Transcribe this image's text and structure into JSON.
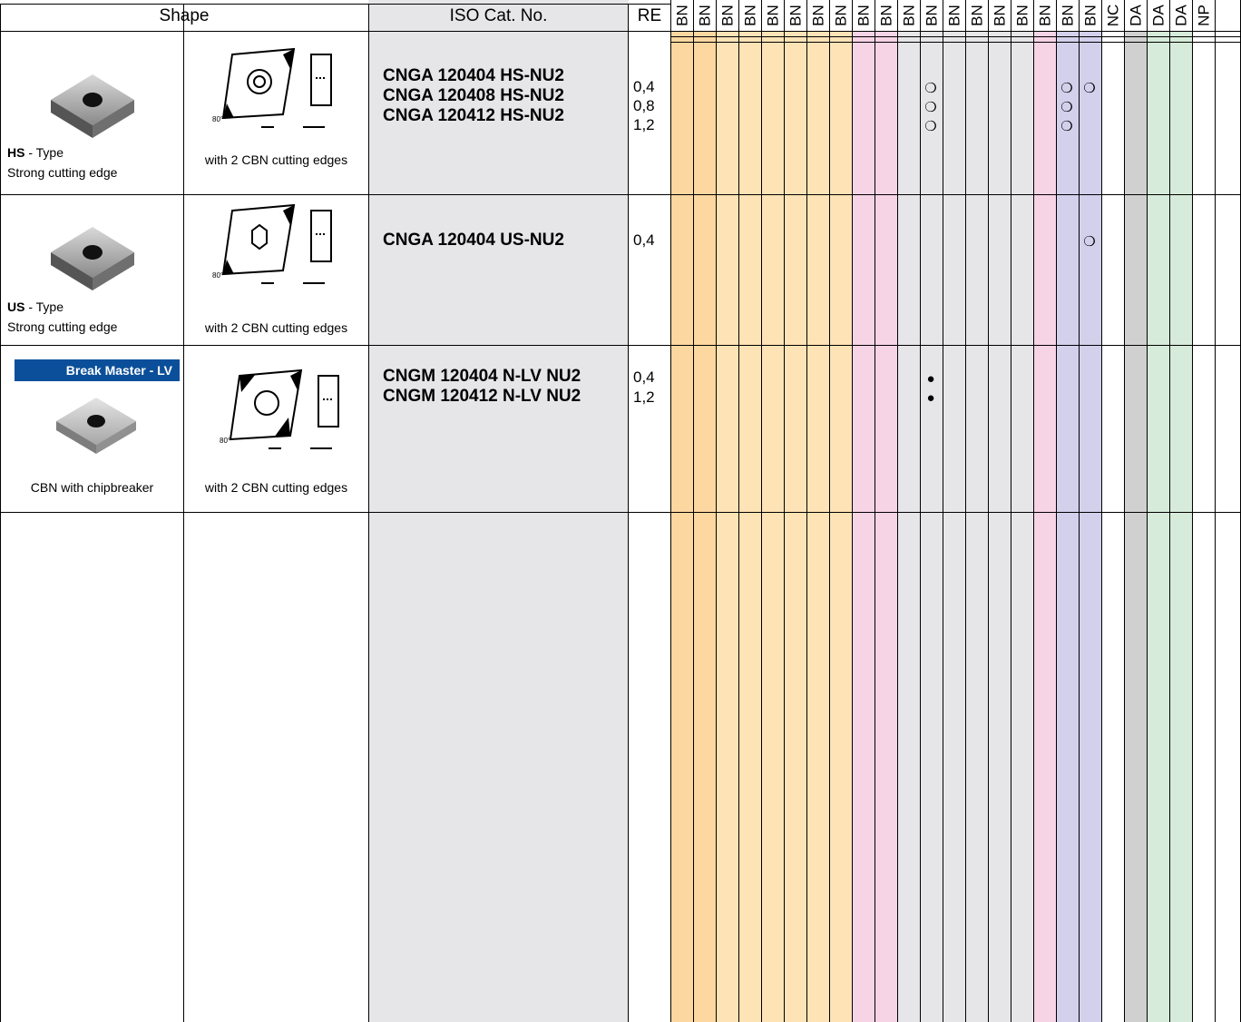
{
  "header": {
    "shape": "Shape",
    "iso": "ISO Cat. No.",
    "re": "RE",
    "grades": [
      "BN",
      "BN",
      "BN",
      "BN",
      "BN",
      "BN",
      "BN",
      "BN",
      "BN",
      "BN",
      "BN",
      "BN",
      "BN",
      "BN",
      "BN",
      "BN",
      "BN",
      "BN",
      "BN",
      "NC",
      "DA",
      "DA",
      "DA",
      "NP"
    ]
  },
  "column_colors": [
    "#fdd7a0",
    "#fdd7a0",
    "#fee3b6",
    "#fee3b6",
    "#fee3b6",
    "#fee3b6",
    "#fee3b6",
    "#fee3b6",
    "#f7d3e6",
    "#f7d3e6",
    "#e6e6e8",
    "#e6e6e8",
    "#e6e6e8",
    "#e6e6e8",
    "#e6e6e8",
    "#e6e6e8",
    "#f7d3e6",
    "#d3d0ec",
    "#d3d0ec",
    "#ffffff",
    "#d0d0d0",
    "#d6ebd9",
    "#d6ebd9",
    "#ffffff"
  ],
  "rows": [
    {
      "type_code": "HS",
      "type_suffix": " - Type",
      "shape_desc": "Strong cutting edge",
      "edges": "with 2 CBN cutting edges",
      "items": [
        "CNGA 120404 HS-NU2",
        "CNGA 120408 HS-NU2",
        "CNGA 120412 HS-NU2"
      ],
      "re": [
        "0,4",
        "0,8",
        "1,2"
      ],
      "marks": [
        {
          "line": 0,
          "col": 11,
          "sym": "❍"
        },
        {
          "line": 1,
          "col": 11,
          "sym": "❍"
        },
        {
          "line": 2,
          "col": 11,
          "sym": "❍"
        },
        {
          "line": 0,
          "col": 17,
          "sym": "❍"
        },
        {
          "line": 1,
          "col": 17,
          "sym": "❍"
        },
        {
          "line": 2,
          "col": 17,
          "sym": "❍"
        },
        {
          "line": 0,
          "col": 18,
          "sym": "❍"
        }
      ]
    },
    {
      "type_code": "US",
      "type_suffix": " - Type",
      "shape_desc": "Strong cutting edge",
      "edges": "with 2 CBN cutting edges",
      "items": [
        "CNGA 120404 US-NU2"
      ],
      "re": [
        "0,4"
      ],
      "marks": [
        {
          "line": 0,
          "col": 18,
          "sym": "❍"
        }
      ]
    },
    {
      "badge": "Break Master - LV",
      "shape_desc": "CBN with chipbreaker",
      "edges": "with 2 CBN cutting edges",
      "items": [
        "CNGM 120404 N-LV NU2",
        "CNGM 120412 N-LV NU2"
      ],
      "re": [
        "0,4",
        "1,2"
      ],
      "marks": [
        {
          "line": 0,
          "col": 11,
          "sym": "●"
        },
        {
          "line": 1,
          "col": 11,
          "sym": "●"
        }
      ]
    }
  ]
}
